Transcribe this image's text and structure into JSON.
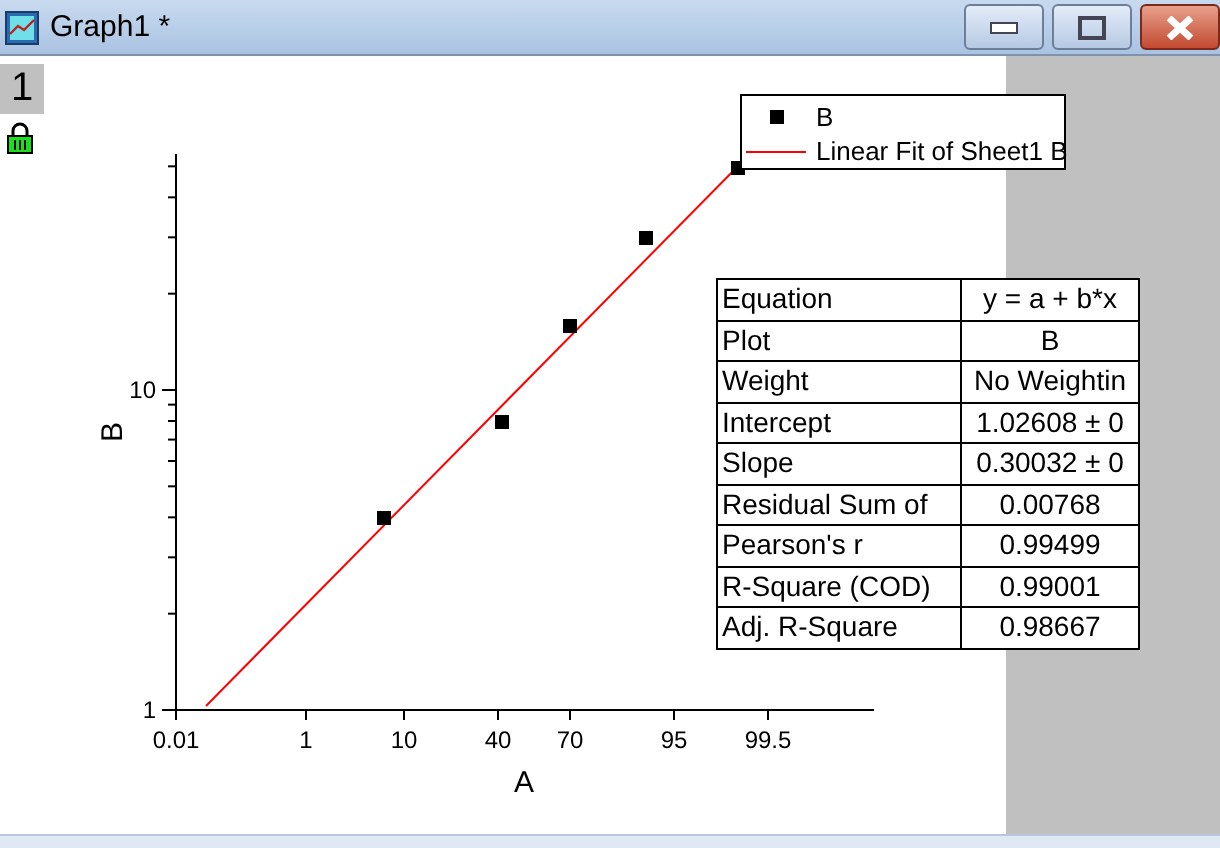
{
  "window": {
    "title": "Graph1 *"
  },
  "layer_tab": "1",
  "graph": {
    "y_axis": {
      "title": "B",
      "tick_labels": [
        "10",
        "1"
      ]
    },
    "x_axis": {
      "title": "A",
      "tick_labels": [
        "0.01",
        "1",
        "10",
        "40",
        "70",
        "95",
        "99.5"
      ]
    },
    "legend": [
      {
        "kind": "marker",
        "label": "B",
        "color": "#000000"
      },
      {
        "kind": "line",
        "label": "Linear Fit of Sheet1 B",
        "color": "#ff0000"
      }
    ],
    "fit_table": [
      {
        "label": "Equation",
        "value": "y = a + b*x"
      },
      {
        "label": "Plot",
        "value": "B"
      },
      {
        "label": "Weight",
        "value": "No Weightin"
      },
      {
        "label": "Intercept",
        "value": "1.02608 ± 0"
      },
      {
        "label": "Slope",
        "value": "0.30032 ± 0"
      },
      {
        "label": "Residual Sum of",
        "value": "0.00768"
      },
      {
        "label": "Pearson's r",
        "value": "0.99499"
      },
      {
        "label": "R-Square (COD)",
        "value": "0.99001"
      },
      {
        "label": "Adj. R-Square",
        "value": "0.98667"
      }
    ]
  }
}
